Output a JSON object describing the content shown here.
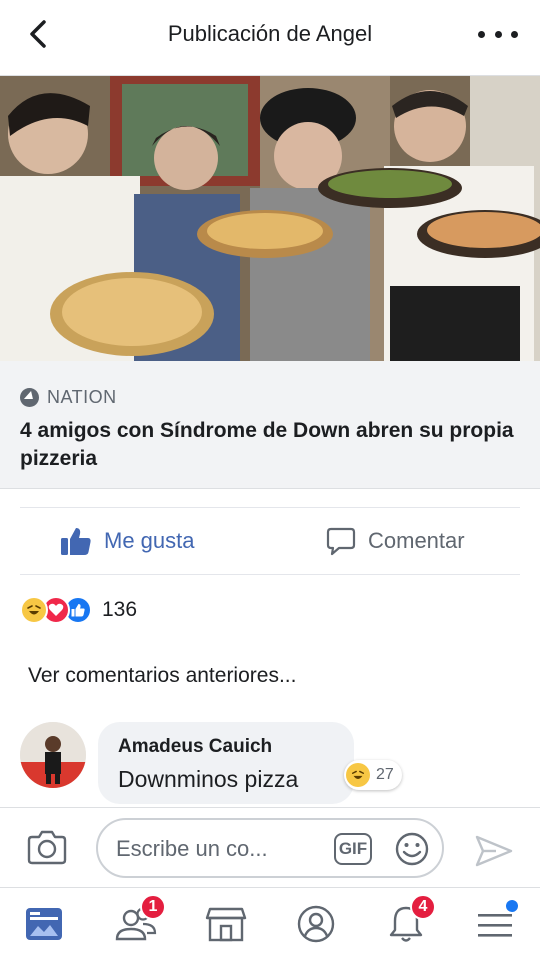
{
  "header": {
    "title": "Publicación de Angel",
    "back_icon": "chevron-left-icon",
    "more_icon": "more-horizontal-icon"
  },
  "post": {
    "image_alt_icon": "photo",
    "link_card": {
      "source": "NATION",
      "headline": "4 amigos con Síndrome de Down abren su propia pizzeria"
    }
  },
  "actions": {
    "like_label": "Me gusta",
    "comment_label": "Comentar"
  },
  "reactions": {
    "count": "136",
    "types": [
      "haha",
      "love",
      "like"
    ]
  },
  "comments": {
    "view_previous": "Ver comentarios anteriores...",
    "items": [
      {
        "author": "Amadeus Cauich",
        "text": "Downminos pizza",
        "reaction_count": "27",
        "reaction_type": "haha"
      }
    ]
  },
  "composer": {
    "placeholder": "Escribe un co...",
    "gif_label": "GIF"
  },
  "bottom_nav": {
    "items": [
      {
        "name": "news-feed",
        "badge": ""
      },
      {
        "name": "friends",
        "badge": "1"
      },
      {
        "name": "marketplace",
        "badge": ""
      },
      {
        "name": "profile",
        "badge": ""
      },
      {
        "name": "notifications",
        "badge": "4"
      },
      {
        "name": "menu",
        "badge": ""
      }
    ]
  },
  "colors": {
    "accent": "#4267b2",
    "badge": "#e41e3f",
    "card_bg": "#f2f3f5"
  }
}
